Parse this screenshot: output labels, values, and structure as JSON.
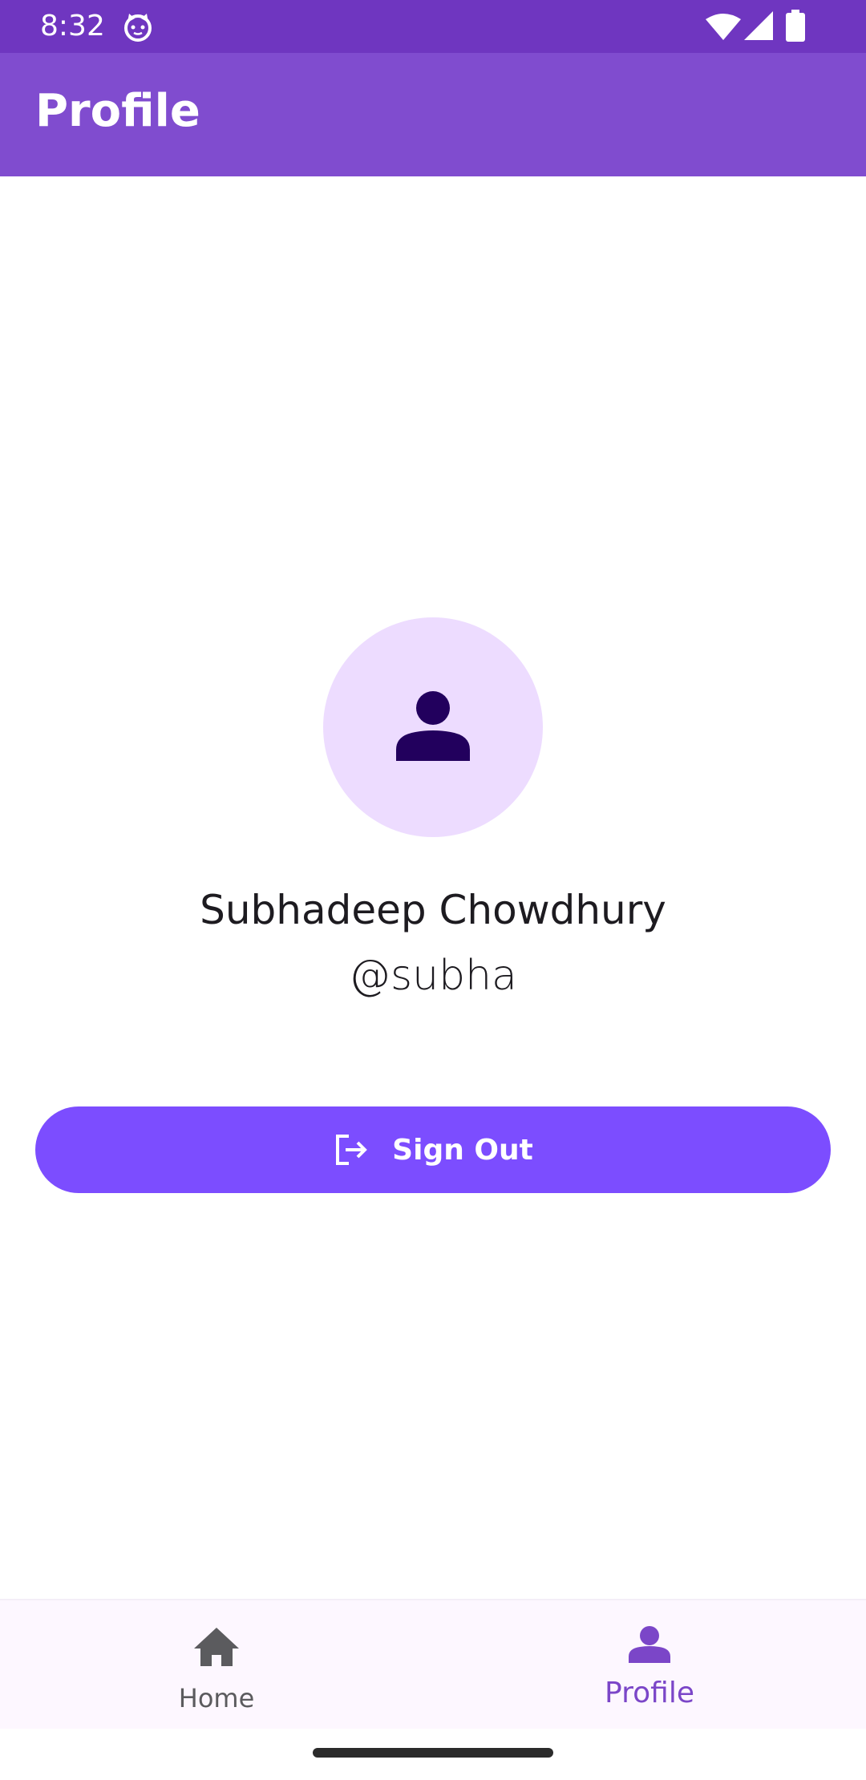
{
  "status_bar": {
    "time": "8:32",
    "icons": [
      "cat-notification-icon",
      "wifi-icon",
      "signal-icon",
      "battery-icon"
    ]
  },
  "app_bar": {
    "title": "Profile"
  },
  "profile": {
    "avatar_icon": "person-icon",
    "full_name": "Subhadeep Chowdhury",
    "username": "@subha"
  },
  "actions": {
    "sign_out_label": "Sign Out",
    "sign_out_icon": "logout-icon"
  },
  "bottom_nav": {
    "items": [
      {
        "label": "Home",
        "icon": "home-icon",
        "selected": false
      },
      {
        "label": "Profile",
        "icon": "person-icon",
        "selected": true
      }
    ]
  },
  "colors": {
    "status_bar": "#6f36c0",
    "app_bar": "#804ccf",
    "avatar_bg": "#eddcff",
    "avatar_icon": "#22005d",
    "button": "#7c4dff",
    "nav_selected": "#7b46c8",
    "nav_unselected": "#5b5b5e"
  }
}
